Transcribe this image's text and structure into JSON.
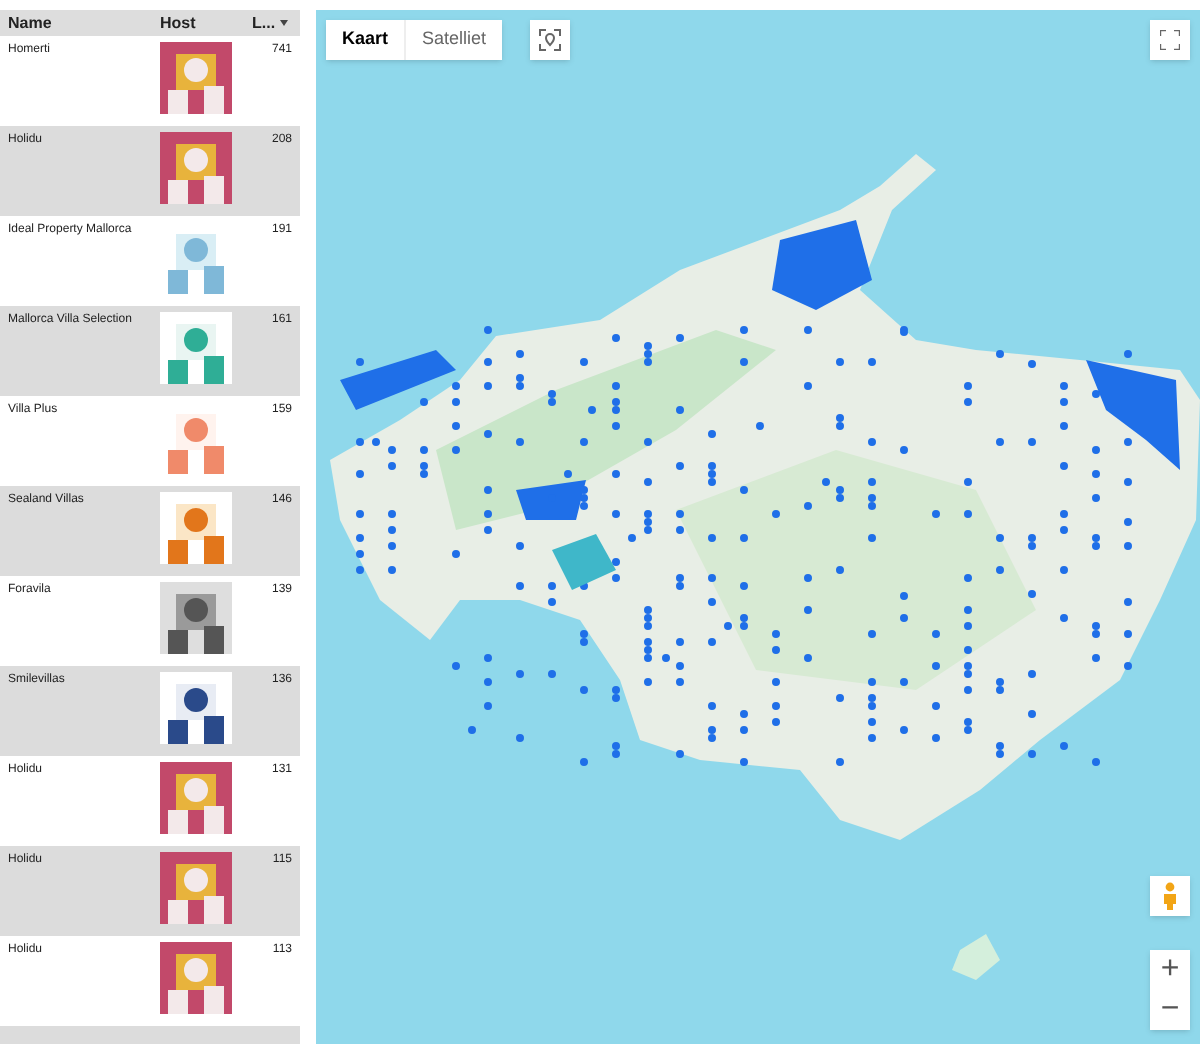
{
  "table": {
    "columns": [
      {
        "label": "Name"
      },
      {
        "label": "Host"
      },
      {
        "label": "L...",
        "sorted_descending": true
      }
    ],
    "rows": [
      {
        "name": "Homerti",
        "count": "741"
      },
      {
        "name": "Holidu",
        "count": "208"
      },
      {
        "name": "Ideal Property Mallorca",
        "count": "191"
      },
      {
        "name": "Mallorca Villa Selection",
        "count": "161"
      },
      {
        "name": "Villa Plus",
        "count": "159"
      },
      {
        "name": "Sealand Villas",
        "count": "146"
      },
      {
        "name": "Foravila",
        "count": "139"
      },
      {
        "name": "Smilevillas",
        "count": "136"
      },
      {
        "name": "Holidu",
        "count": "131"
      },
      {
        "name": "Holidu",
        "count": "115"
      },
      {
        "name": "Holidu",
        "count": "113"
      }
    ]
  },
  "map": {
    "kind": "picture",
    "map_types": [
      {
        "label": "Kaart",
        "selected": true
      },
      {
        "label": "Satelliet",
        "selected": false
      }
    ],
    "zoom_in": "+",
    "zoom_out": "−"
  }
}
